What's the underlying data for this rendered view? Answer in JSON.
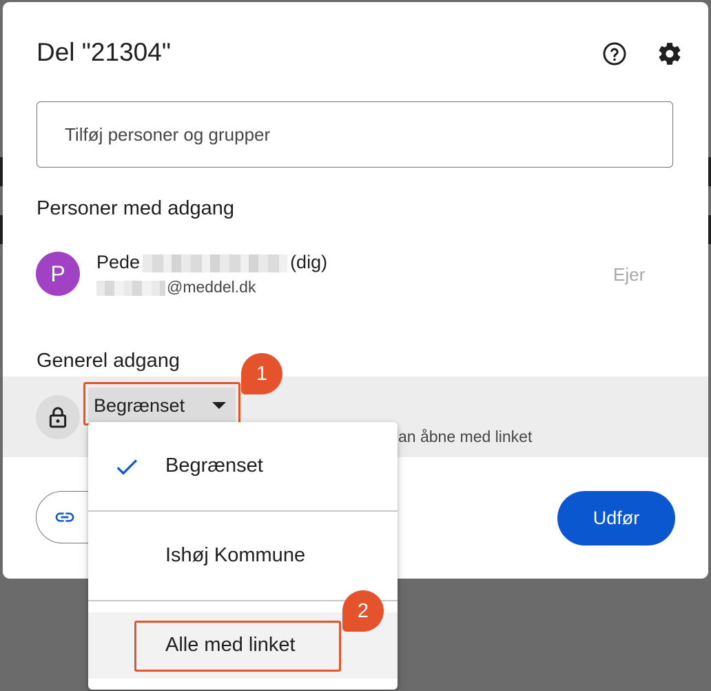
{
  "dialog": {
    "title": "Del \"21304\"",
    "help_icon": "help-circle-icon",
    "settings_icon": "gear-icon"
  },
  "add_people": {
    "placeholder": "Tilføj personer og grupper"
  },
  "people_section": {
    "heading": "Personer med adgang",
    "person": {
      "avatar_letter": "P",
      "avatar_color": "#a142c4",
      "name_visible": "Pede",
      "name_suffix": "(dig)",
      "email_domain": "@meddel.dk",
      "role": "Ejer"
    }
  },
  "general_access": {
    "heading": "Generel adgang",
    "lock_icon": "lock-icon",
    "selected": "Begrænset",
    "description_visible": "an åbne med linket"
  },
  "dropdown_menu": {
    "items": [
      {
        "label": "Begrænset",
        "checked": true
      },
      {
        "label": "Ishøj Kommune",
        "checked": false
      },
      {
        "label": "Alle med linket",
        "checked": false
      }
    ]
  },
  "footer": {
    "copy_link_icon": "link-icon",
    "done_label": "Udfør",
    "done_color": "#0b57d0"
  },
  "annotations": {
    "step1": "1",
    "step2": "2",
    "color": "#e5532d"
  }
}
